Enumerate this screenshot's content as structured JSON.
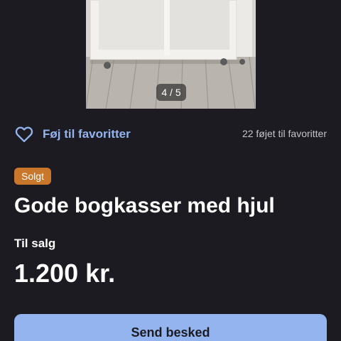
{
  "listing": {
    "image_counter": "4 / 5",
    "favorite_label": "Føj til favoritter",
    "favorite_count_text": "22 føjet til favoritter",
    "status_badge": "Solgt",
    "title": "Gode bogkasser med hjul",
    "sale_type": "Til salg",
    "price": "1.200 kr.",
    "send_button": "Send besked"
  },
  "colors": {
    "background": "#1c1b22",
    "accent": "#93b4ee",
    "badge": "#c9772b"
  },
  "icons": {
    "favorite": "heart-outline-icon"
  }
}
